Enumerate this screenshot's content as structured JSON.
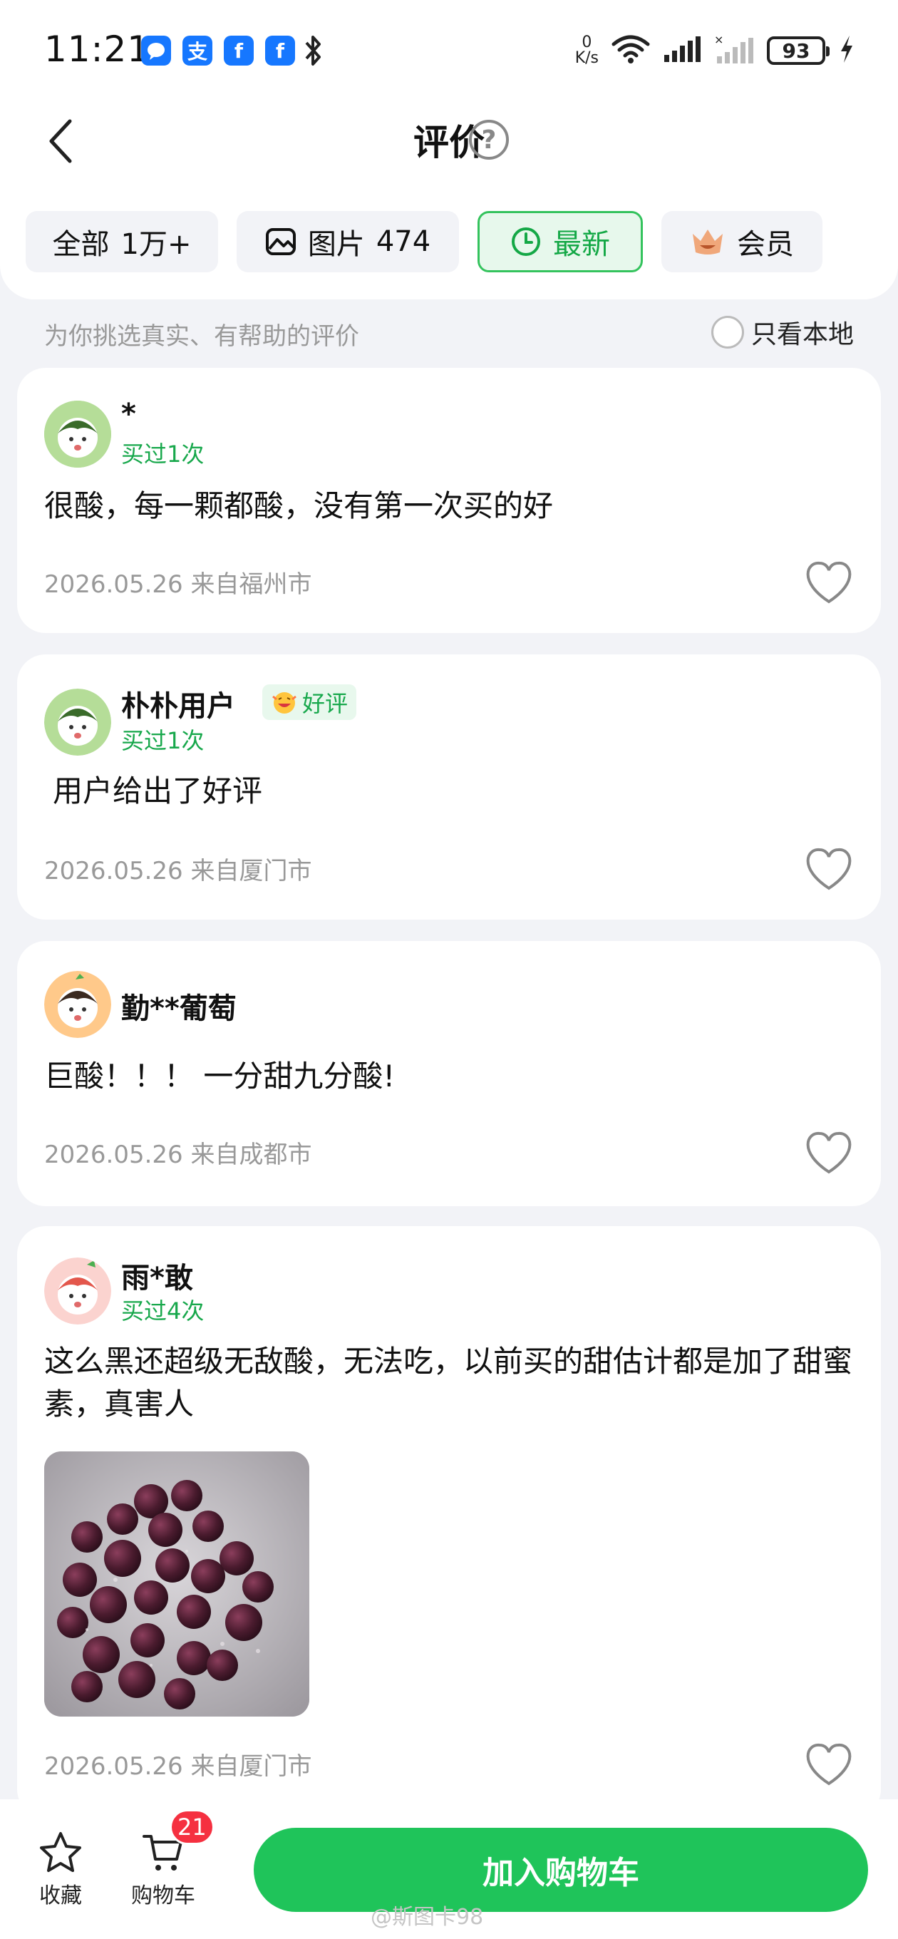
{
  "status_bar": {
    "time": "11:21",
    "net_speed_value": "0",
    "net_speed_unit": "K/s",
    "battery": "93",
    "app_icons": [
      "message-icon",
      "alipay-icon",
      "facebook-icon",
      "facebook-icon",
      "bluetooth-icon"
    ]
  },
  "header": {
    "title": "评价",
    "help_glyph": "?"
  },
  "tabs": [
    {
      "label": "全部",
      "count": "1万+",
      "active": false
    },
    {
      "label": "图片",
      "count": "474",
      "active": false
    },
    {
      "label": "最新",
      "count": "",
      "active": true
    },
    {
      "label": "会员",
      "count": "",
      "active": false
    }
  ],
  "filter": {
    "hint": "为你挑选真实、有帮助的评价",
    "local_only_label": "只看本地"
  },
  "reviews": [
    {
      "name": "*",
      "bought": "买过1次",
      "badge": "",
      "content": "很酸，每一颗都酸，没有第一次买的好",
      "date": "2026.05.26",
      "location": "来自福州市",
      "has_photo": false
    },
    {
      "name": "朴朴用户",
      "bought": "买过1次",
      "badge": "好评",
      "content": "用户给出了好评",
      "date": "2026.05.26",
      "location": "来自厦门市",
      "has_photo": false
    },
    {
      "name": "勤**葡萄",
      "bought": "",
      "badge": "",
      "content": "巨酸！！！ 一分甜九分酸!",
      "date": "2026.05.26",
      "location": "来自成都市",
      "has_photo": false
    },
    {
      "name": "雨*敢",
      "bought": "买过4次",
      "badge": "",
      "content": "这么黑还超级无敌酸，无法吃，以前买的甜估计都是加了甜蜜素，真害人",
      "date": "2026.05.26",
      "location": "来自厦门市",
      "has_photo": true
    }
  ],
  "bottom_bar": {
    "favorite_label": "收藏",
    "cart_label": "购物车",
    "cart_count": "21",
    "add_to_cart_label": "加入购物车"
  },
  "watermark": "@斯图卡98",
  "colors": {
    "accent_green": "#1fc45a",
    "text_green": "#18a84c",
    "badge_red": "#f53040",
    "page_bg": "#f2f3f7"
  }
}
